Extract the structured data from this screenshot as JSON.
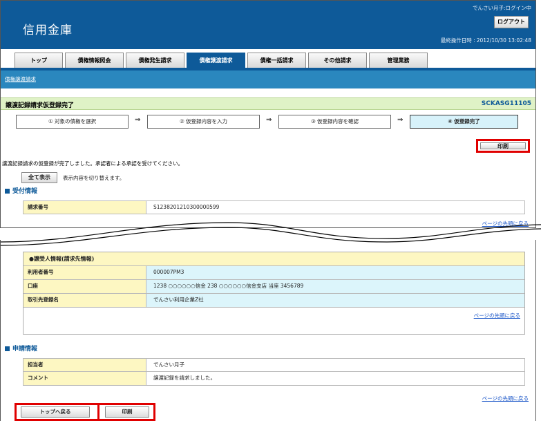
{
  "header": {
    "bank_name": "信用金庫",
    "user_status": "でんさい月子:ログイン中",
    "logout_label": "ログアウト",
    "last_op_label": "最終操作日時 :",
    "last_op_value": "2012/10/30 13:02:48"
  },
  "tabs": [
    {
      "label": "トップ"
    },
    {
      "label": "債権情報照会"
    },
    {
      "label": "債権発生請求"
    },
    {
      "label": "債権譲渡請求"
    },
    {
      "label": "債権一括請求"
    },
    {
      "label": "その他請求"
    },
    {
      "label": "管理業務"
    }
  ],
  "active_tab": "債権譲渡請求",
  "breadcrumb": "債権譲渡請求",
  "page": {
    "title": "譲渡記録請求仮登録完了",
    "screen_id": "SCKASG11105"
  },
  "steps": [
    {
      "label": "① 対象の債権を選択"
    },
    {
      "label": "② 仮登録内容を入力"
    },
    {
      "label": "③ 仮登録内容を確認"
    },
    {
      "label": "④ 仮登録完了"
    }
  ],
  "arrow_glyph": "⇒",
  "print_label": "印刷",
  "message": "譲渡記録請求の仮登録が完了しました。承認者による承認を受けてください。",
  "show_all_label": "全て表示",
  "toggle_hint": "表示内容を切り替えます。",
  "reception": {
    "heading": "受付情報",
    "request_no_label": "請求番号",
    "request_no_value": "S1238201210300000599"
  },
  "page_top_link": "ページの先頭に戻る",
  "recipient": {
    "heading": "●譲受人情報(請求先情報)",
    "rows": [
      {
        "label": "利用者番号",
        "value": "000007PM3"
      },
      {
        "label": "口座",
        "value": "1238 ○○○○○○信金 238 ○○○○○○信金支店 当座 3456789"
      },
      {
        "label": "取引先登録名",
        "value": "でんさい利用企業Z社"
      }
    ]
  },
  "application": {
    "heading": "申請情報",
    "rows": [
      {
        "label": "担当者",
        "value": "でんさい月子"
      },
      {
        "label": "コメント",
        "value": "譲渡記録を請求しました。"
      }
    ]
  },
  "footer": {
    "back_top_label": "トップへ戻る",
    "print_label": "印刷"
  },
  "colors": {
    "header_blue": "#0e5a99",
    "subnav_blue": "#2a87be",
    "title_green": "#dff2c6",
    "label_yellow": "#fdf7c2",
    "value_blue": "#dcf5fb",
    "highlight_red": "#e00000",
    "link_blue": "#1a56c8"
  }
}
